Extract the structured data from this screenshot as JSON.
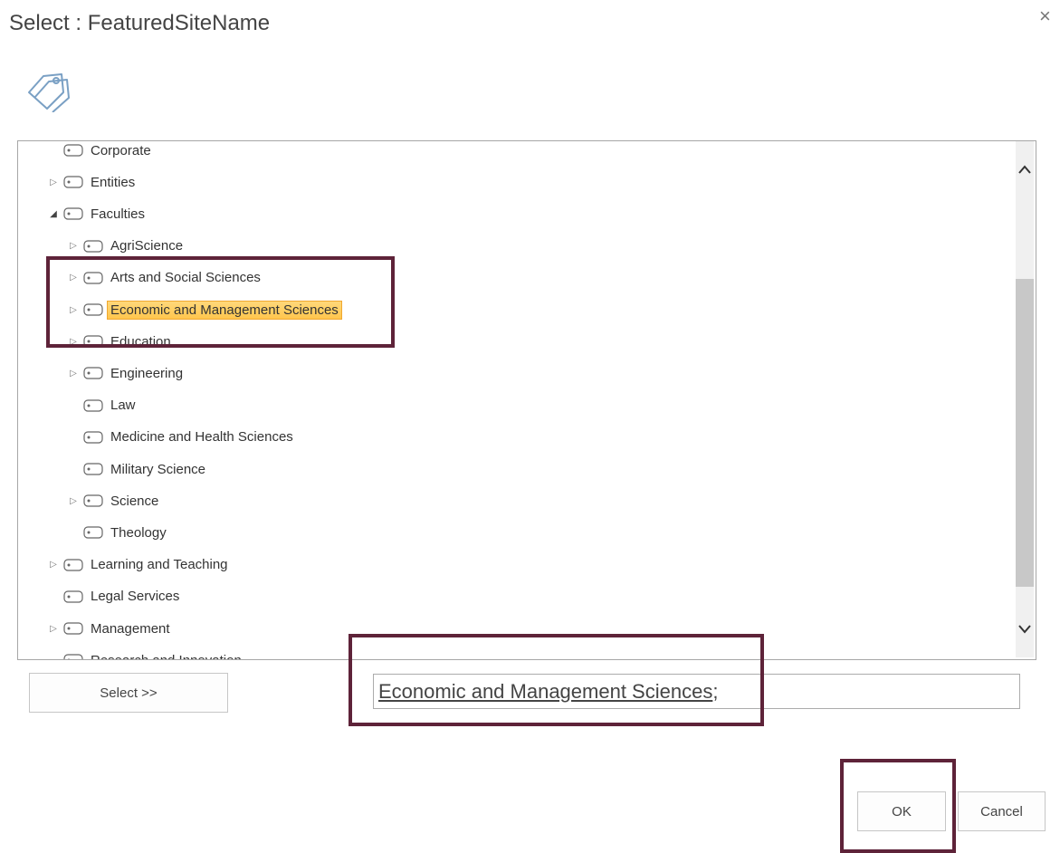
{
  "dialog": {
    "title": "Select : FeaturedSiteName",
    "close_glyph": "×"
  },
  "icons": {
    "tags": "tags-icon",
    "term": "term-tag-icon",
    "collapsed": "triangle-right-icon",
    "expanded": "triangle-down-icon"
  },
  "tree": {
    "nodes": [
      {
        "label": "Corporate",
        "level": 0,
        "state": "leaf"
      },
      {
        "label": "Entities",
        "level": 0,
        "state": "collapsed"
      },
      {
        "label": "Faculties",
        "level": 0,
        "state": "expanded"
      },
      {
        "label": "AgriScience",
        "level": 1,
        "state": "collapsed"
      },
      {
        "label": "Arts and Social Sciences",
        "level": 1,
        "state": "collapsed"
      },
      {
        "label": "Economic and Management Sciences",
        "level": 1,
        "state": "collapsed",
        "selected": true
      },
      {
        "label": "Education",
        "level": 1,
        "state": "collapsed"
      },
      {
        "label": "Engineering",
        "level": 1,
        "state": "collapsed"
      },
      {
        "label": "Law",
        "level": 1,
        "state": "leaf"
      },
      {
        "label": "Medicine and Health Sciences",
        "level": 1,
        "state": "leaf"
      },
      {
        "label": "Military Science",
        "level": 1,
        "state": "leaf"
      },
      {
        "label": "Science",
        "level": 1,
        "state": "collapsed"
      },
      {
        "label": "Theology",
        "level": 1,
        "state": "leaf"
      },
      {
        "label": "Learning and Teaching",
        "level": 0,
        "state": "collapsed"
      },
      {
        "label": "Legal Services",
        "level": 0,
        "state": "leaf"
      },
      {
        "label": "Management",
        "level": 0,
        "state": "collapsed"
      },
      {
        "label": "Research and Innovation",
        "level": 0,
        "state": "leaf"
      }
    ]
  },
  "actions": {
    "select_label": "Select >>",
    "selected_value": "Economic and Management Sciences",
    "value_separator": ";",
    "ok_label": "OK",
    "cancel_label": "Cancel"
  },
  "colors": {
    "highlight_box": "#5e2339",
    "selection_fill": "#ffc64d"
  }
}
